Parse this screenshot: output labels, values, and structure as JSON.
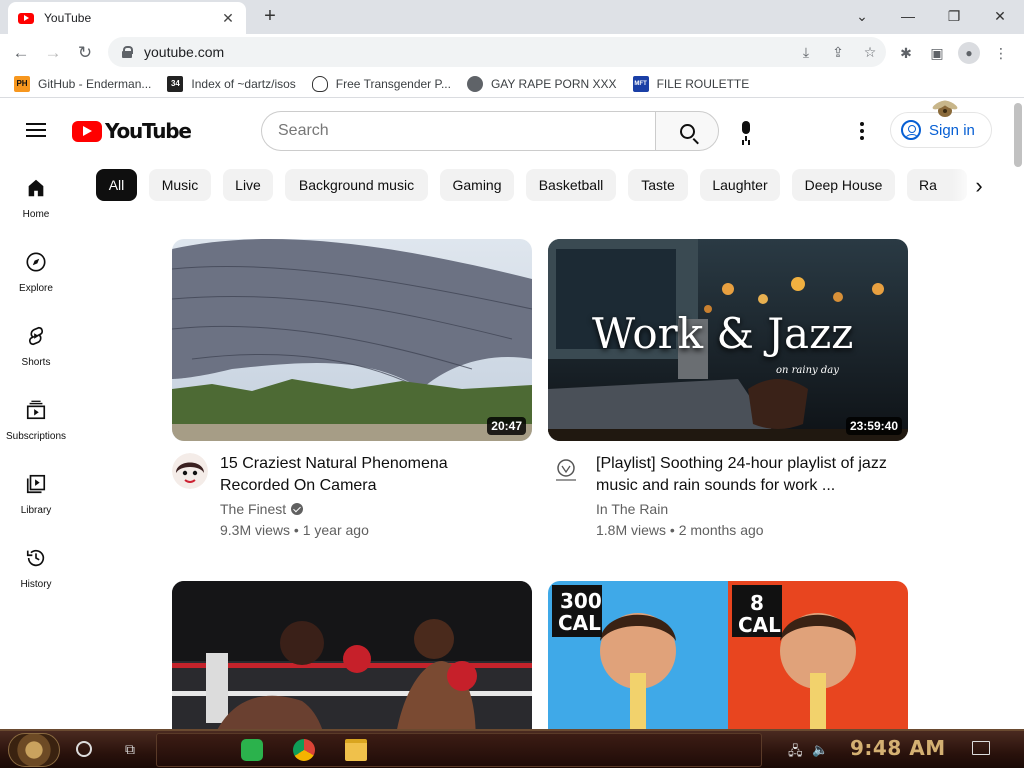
{
  "browser": {
    "tab_title": "YouTube",
    "new_tab": "+",
    "url": "youtube.com",
    "bookmarks": [
      {
        "label": "GitHub - Enderman...",
        "icon": "ph-icon",
        "icon_text": "PH"
      },
      {
        "label": "Index of ~dartz/isos",
        "icon": "34-icon",
        "icon_text": "34"
      },
      {
        "label": "Free Transgender P...",
        "icon": "mask-icon",
        "icon_text": ""
      },
      {
        "label": "GAY RAPE PORN XXX",
        "icon": "globe-icon",
        "icon_text": ""
      },
      {
        "label": "FILE ROULETTE",
        "icon": "mft-icon",
        "icon_text": "MFT"
      }
    ]
  },
  "youtube": {
    "logo_text": "YouTube",
    "search_placeholder": "Search",
    "signin_label": "Sign in",
    "chips": [
      "All",
      "Music",
      "Live",
      "Background music",
      "Gaming",
      "Basketball",
      "Taste",
      "Laughter",
      "Deep House",
      "Ra"
    ],
    "guide": [
      {
        "label": "Home",
        "icon": "home-icon"
      },
      {
        "label": "Explore",
        "icon": "compass-icon"
      },
      {
        "label": "Shorts",
        "icon": "shorts-icon"
      },
      {
        "label": "Subscriptions",
        "icon": "subscriptions-icon"
      },
      {
        "label": "Library",
        "icon": "library-icon"
      },
      {
        "label": "History",
        "icon": "history-icon"
      }
    ],
    "videos": [
      {
        "title": "15 Craziest Natural Phenomena Recorded On Camera",
        "channel": "The Finest",
        "verified": true,
        "views": "9.3M views",
        "age": "1 year ago",
        "duration": "20:47"
      },
      {
        "title": "[Playlist] Soothing 24-hour playlist of jazz music and rain sounds for work ...",
        "channel": "In The Rain",
        "verified": false,
        "views": "1.8M views",
        "age": "2 months ago",
        "duration": "23:59:40",
        "thumb_text": "Work & Jazz",
        "thumb_subtext": "on rainy day"
      },
      {
        "title": "",
        "channel": "",
        "views": "",
        "age": "",
        "duration": ""
      },
      {
        "title": "",
        "channel": "",
        "views": "",
        "age": "",
        "duration": "",
        "thumb_labels": [
          "300",
          "CAL",
          "8",
          "CAL"
        ]
      }
    ]
  },
  "taskbar": {
    "clock": "9:48 AM"
  },
  "colors": {
    "youtube_red": "#ff0000",
    "link_blue": "#065fd4",
    "clock_gold": "#d4b072"
  }
}
